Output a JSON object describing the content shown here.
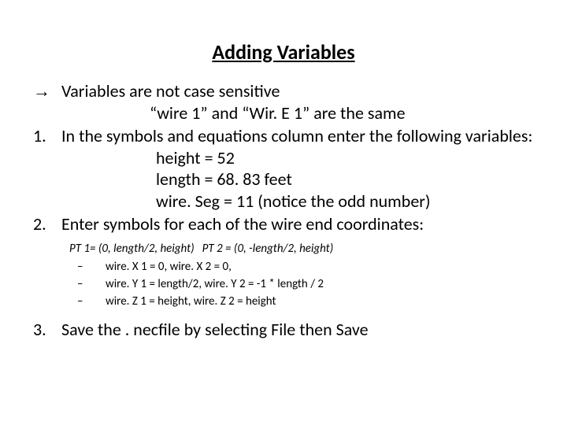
{
  "title": "Adding Variables",
  "arrow_glyph": "→",
  "bullet_arrow": "Variables are not case sensitive",
  "arrow_sub": "“wire 1” and “Wir. E 1” are the same",
  "item1_marker": "1.",
  "item1_text": "In the symbols and equations column enter the following variables:",
  "defs": {
    "d1": "height = 52",
    "d2": "length = 68. 83 feet",
    "d3": "wire. Seg = 11  (notice the odd number)"
  },
  "item2_marker": "2.",
  "item2_text": "Enter symbols for each of the wire end coordinates:",
  "pt_line_a": "PT 1= (0, length/2, height)",
  "pt_line_b": "PT 2 = (0, -length/2, height)",
  "dash": "–",
  "sub": {
    "s1": "wire. X 1 = 0, wire. X 2 = 0,",
    "s2": "wire. Y 1 = length/2, wire. Y 2 = -1 * length / 2",
    "s3": "wire. Z 1 = height, wire. Z 2 = height"
  },
  "item3_marker": "3.",
  "item3_text": "Save the . necfile by selecting File then Save"
}
